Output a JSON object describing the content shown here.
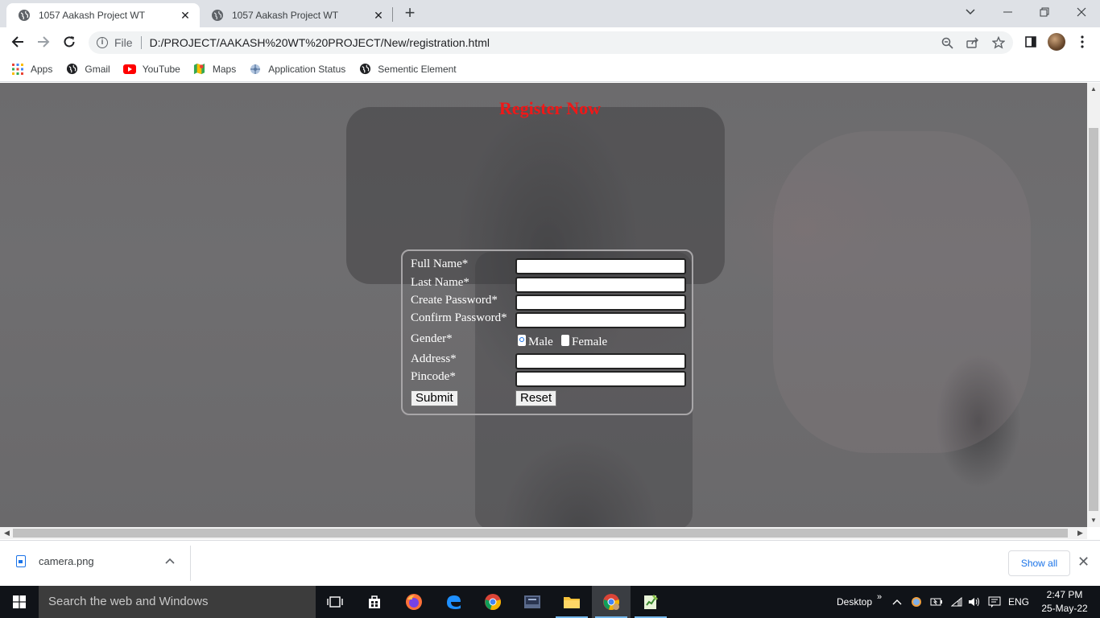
{
  "browser": {
    "tabs": [
      {
        "title": "1057 Aakash Project WT",
        "active": true
      },
      {
        "title": "1057 Aakash Project WT",
        "active": false
      }
    ],
    "address": {
      "scheme_label": "File",
      "url": "D:/PROJECT/AAKASH%20WT%20PROJECT/New/registration.html"
    },
    "bookmarks": [
      {
        "label": "Apps",
        "icon": "apps-grid-icon"
      },
      {
        "label": "Gmail",
        "icon": "globe-icon"
      },
      {
        "label": "YouTube",
        "icon": "youtube-icon"
      },
      {
        "label": "Maps",
        "icon": "maps-icon"
      },
      {
        "label": "Application Status",
        "icon": "app-status-icon"
      },
      {
        "label": "Sementic Element",
        "icon": "globe-icon"
      }
    ]
  },
  "page": {
    "title": "Register Now",
    "title_color": "#f01818",
    "form": {
      "full_name_label": "Full Name*",
      "last_name_label": "Last Name*",
      "create_password_label": "Create Password*",
      "confirm_password_label": "Confirm Password*",
      "gender_label": "Gender*",
      "gender_options": [
        "Male",
        "Female"
      ],
      "gender_selected": "Male",
      "address_label": "Address*",
      "pincode_label": "Pincode*",
      "submit_label": "Submit",
      "reset_label": "Reset"
    }
  },
  "downloads": {
    "file_name": "camera.png",
    "show_all_label": "Show all"
  },
  "taskbar": {
    "search_placeholder": "Search the web and Windows",
    "desktop_label": "Desktop",
    "language": "ENG",
    "time": "2:47 PM",
    "date": "25-May-22"
  }
}
